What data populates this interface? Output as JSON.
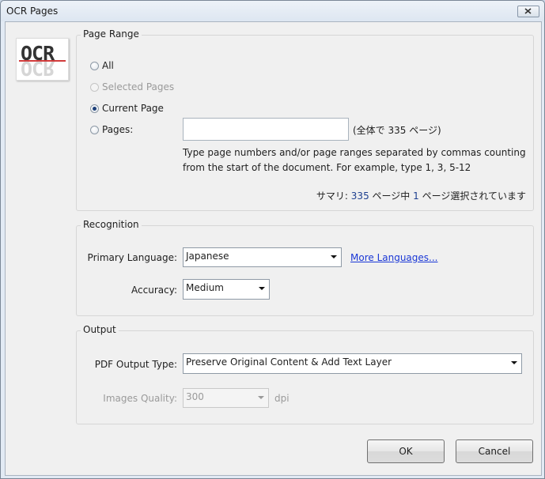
{
  "window": {
    "title": "OCR Pages"
  },
  "logo": {
    "text": "OCR"
  },
  "page_range": {
    "group_label": "Page Range",
    "options": {
      "all": "All",
      "selected": "Selected Pages",
      "current": "Current Page",
      "pages": "Pages:"
    },
    "pages_input": {
      "value": ""
    },
    "total_hint_prefix": "(全体で",
    "total_pages": "335",
    "total_hint_suffix": "ページ)",
    "help_text_line1": "Type page numbers and/or page ranges separated by commas counting",
    "help_text_line2": "from the start of the document. For example, type 1, 3, 5-12",
    "summary": {
      "prefix": "サマリ:",
      "total": "335",
      "middle": "ページ中",
      "selected": "1",
      "suffix": "ページ選択されています"
    },
    "selected_option": "current"
  },
  "recognition": {
    "group_label": "Recognition",
    "language_label": "Primary Language:",
    "language_value": "Japanese",
    "more_languages": "More Languages...",
    "accuracy_label": "Accuracy:",
    "accuracy_value": "Medium"
  },
  "output": {
    "group_label": "Output",
    "type_label": "PDF Output Type:",
    "type_value": "Preserve Original Content & Add Text Layer",
    "quality_label": "Images Quality:",
    "quality_value": "300",
    "quality_unit": "dpi"
  },
  "buttons": {
    "ok": "OK",
    "cancel": "Cancel"
  }
}
